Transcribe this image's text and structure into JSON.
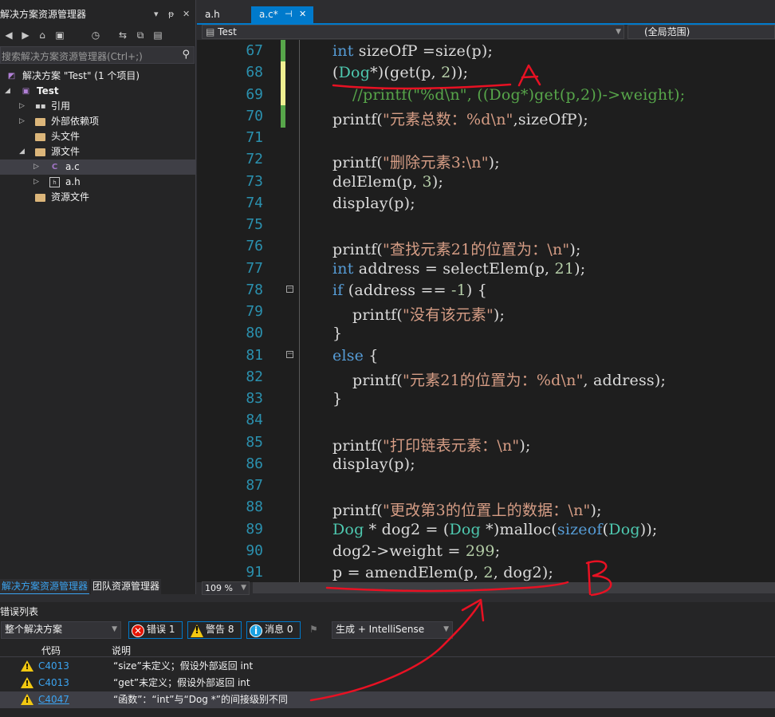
{
  "solution_explorer": {
    "title": "解决方案资源管理器",
    "title_controls": [
      "▾",
      "ᵽ",
      "✕"
    ],
    "toolbar_icons": [
      "back-icon",
      "forward-icon",
      "home-icon",
      "switch-view-icon",
      "history-icon",
      "sync-icon",
      "collapse-all-icon",
      "properties-icon"
    ],
    "search_placeholder": "搜索解决方案资源管理器(Ctrl+;)",
    "tree": [
      {
        "label": "解决方案 \"Test\" (1 个项目)",
        "icon": "solution-icon"
      },
      {
        "label": "Test",
        "icon": "project-icon",
        "bold": true
      },
      {
        "label": "引用",
        "icon": "references-icon"
      },
      {
        "label": "外部依赖项",
        "icon": "external-deps-icon"
      },
      {
        "label": "头文件",
        "icon": "folder-icon"
      },
      {
        "label": "源文件",
        "icon": "folder-icon"
      },
      {
        "label": "a.c",
        "icon": "c-file-icon",
        "selected": true
      },
      {
        "label": "a.h",
        "icon": "h-file-icon"
      },
      {
        "label": "资源文件",
        "icon": "folder-icon"
      }
    ],
    "bottom_tabs": [
      "解决方案资源管理器",
      "团队资源管理器"
    ]
  },
  "editor": {
    "tabs": [
      {
        "label": "a.h",
        "active": false
      },
      {
        "label": "a.c*",
        "active": true,
        "pin": "⊣",
        "close": "✕"
      }
    ],
    "nav_left": "Test",
    "nav_right": "(全局范围)",
    "zoom": "109 %",
    "lines": [
      {
        "n": "67",
        "text": "int sizeOfP =size(p);"
      },
      {
        "n": "68",
        "text": "(Dog*)(get(p, 2));"
      },
      {
        "n": "69",
        "text": "    //printf(\"%d\\n\", ((Dog*)get(p,2))->weight);"
      },
      {
        "n": "70",
        "text": "printf(\"元素总数：%d\\n\",sizeOfP);"
      },
      {
        "n": "71",
        "text": ""
      },
      {
        "n": "72",
        "text": "printf(\"删除元素3:\\n\");"
      },
      {
        "n": "73",
        "text": "delElem(p, 3);"
      },
      {
        "n": "74",
        "text": "display(p);"
      },
      {
        "n": "75",
        "text": ""
      },
      {
        "n": "76",
        "text": "printf(\"查找元素21的位置为：\\n\");"
      },
      {
        "n": "77",
        "text": "int address = selectElem(p, 21);"
      },
      {
        "n": "78",
        "text": "if (address == -1) {"
      },
      {
        "n": "79",
        "text": "    printf(\"没有该元素\");"
      },
      {
        "n": "80",
        "text": "}"
      },
      {
        "n": "81",
        "text": "else {"
      },
      {
        "n": "82",
        "text": "    printf(\"元素21的位置为：%d\\n\", address);"
      },
      {
        "n": "83",
        "text": "}"
      },
      {
        "n": "84",
        "text": ""
      },
      {
        "n": "85",
        "text": "printf(\"打印链表元素：\\n\");"
      },
      {
        "n": "86",
        "text": "display(p);"
      },
      {
        "n": "87",
        "text": ""
      },
      {
        "n": "88",
        "text": "printf(\"更改第3的位置上的数据：\\n\");"
      },
      {
        "n": "89",
        "text": "Dog * dog2 = (Dog *)malloc(sizeof(Dog));"
      },
      {
        "n": "90",
        "text": "dog2->weight = 299;"
      },
      {
        "n": "91",
        "text": "p = amendElem(p, 2, dog2);"
      }
    ]
  },
  "error_list": {
    "title": "错误列表",
    "scope": "整个解决方案",
    "errors_label": "错误 1",
    "warnings_label": "警告 8",
    "messages_label": "消息 0",
    "source_filter": "生成 + IntelliSense",
    "col_code": "代码",
    "col_desc": "说明",
    "rows": [
      {
        "code": "C4013",
        "desc": "“size”未定义；假设外部返回 int"
      },
      {
        "code": "C4013",
        "desc": "“get”未定义；假设外部返回 int"
      },
      {
        "code": "C4047",
        "desc": "“函数”：“int”与“Dog *”的间接级别不同"
      }
    ]
  },
  "annotations": {
    "label_a": "A",
    "label_b": "B",
    "color": "#e81123"
  }
}
